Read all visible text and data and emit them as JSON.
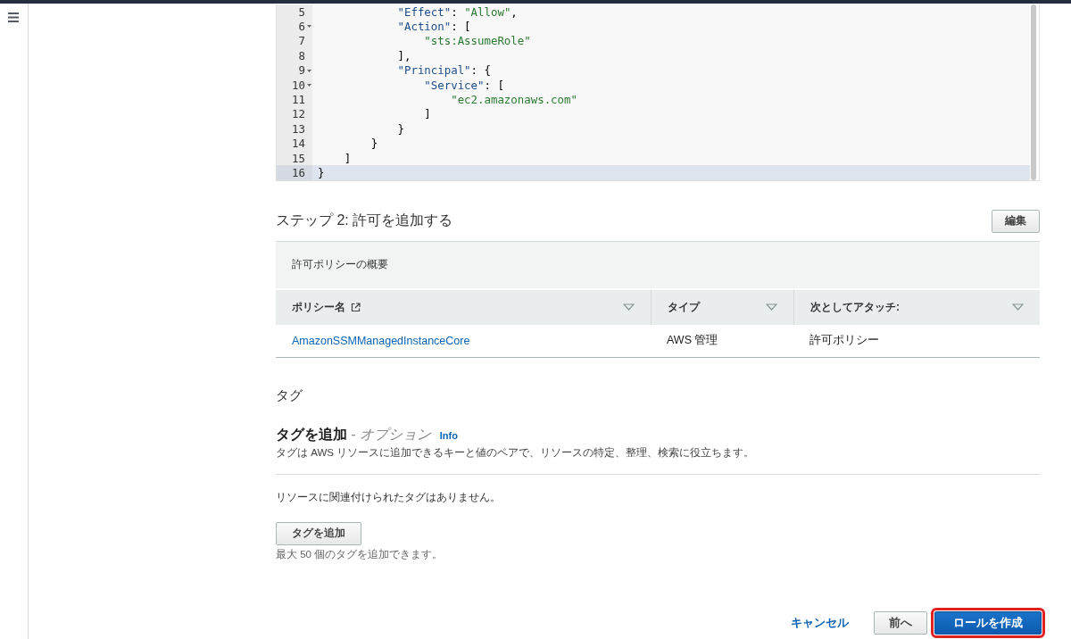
{
  "editor": {
    "lines": [
      {
        "number": "5",
        "fold": false,
        "current": false,
        "tokens": [
          {
            "kind": "key",
            "text": "            \"Effect\""
          },
          {
            "kind": "punct",
            "text": ": "
          },
          {
            "kind": "string",
            "text": "\"Allow\""
          },
          {
            "kind": "punct",
            "text": ","
          }
        ]
      },
      {
        "number": "6",
        "fold": true,
        "current": false,
        "tokens": [
          {
            "kind": "key",
            "text": "            \"Action\""
          },
          {
            "kind": "punct",
            "text": ": ["
          }
        ]
      },
      {
        "number": "7",
        "fold": false,
        "current": false,
        "tokens": [
          {
            "kind": "string",
            "text": "                \"sts:AssumeRole\""
          }
        ]
      },
      {
        "number": "8",
        "fold": false,
        "current": false,
        "tokens": [
          {
            "kind": "punct",
            "text": "            ],"
          }
        ]
      },
      {
        "number": "9",
        "fold": true,
        "current": false,
        "tokens": [
          {
            "kind": "key",
            "text": "            \"Principal\""
          },
          {
            "kind": "punct",
            "text": ": {"
          }
        ]
      },
      {
        "number": "10",
        "fold": true,
        "current": false,
        "tokens": [
          {
            "kind": "key",
            "text": "                \"Service\""
          },
          {
            "kind": "punct",
            "text": ": ["
          }
        ]
      },
      {
        "number": "11",
        "fold": false,
        "current": false,
        "tokens": [
          {
            "kind": "string",
            "text": "                    \"ec2.amazonaws.com\""
          }
        ]
      },
      {
        "number": "12",
        "fold": false,
        "current": false,
        "tokens": [
          {
            "kind": "punct",
            "text": "                ]"
          }
        ]
      },
      {
        "number": "13",
        "fold": false,
        "current": false,
        "tokens": [
          {
            "kind": "punct",
            "text": "            }"
          }
        ]
      },
      {
        "number": "14",
        "fold": false,
        "current": false,
        "tokens": [
          {
            "kind": "punct",
            "text": "        }"
          }
        ]
      },
      {
        "number": "15",
        "fold": false,
        "current": false,
        "tokens": [
          {
            "kind": "punct",
            "text": "    ]"
          }
        ]
      },
      {
        "number": "16",
        "fold": false,
        "current": true,
        "tokens": [
          {
            "kind": "punct",
            "text": "}"
          }
        ]
      }
    ]
  },
  "step2": {
    "title": "ステップ 2: 許可を追加する",
    "edit_button": "編集",
    "table": {
      "caption": "許可ポリシーの概要",
      "columns": [
        {
          "label": "ポリシー名",
          "external_link": true
        },
        {
          "label": "タイプ",
          "external_link": false
        },
        {
          "label": "次としてアタッチ:",
          "external_link": false
        }
      ],
      "rows": [
        [
          "AmazonSSMManagedInstanceCore",
          "AWS 管理",
          "許可ポリシー"
        ]
      ]
    }
  },
  "tags": {
    "heading": "タグ",
    "title": "タグを追加",
    "optional": "- オプション",
    "info_link": "Info",
    "description": "タグは AWS リソースに追加できるキーと値のペアで、リソースの特定、整理、検索に役立ちます。",
    "empty_message": "リソースに関連付けられたタグはありません。",
    "add_button": "タグを追加",
    "limit_hint": "最大 50 個のタグを追加できます。"
  },
  "footer": {
    "cancel": "キャンセル",
    "previous": "前へ",
    "create": "ロールを作成",
    "create_highlighted": true
  }
}
